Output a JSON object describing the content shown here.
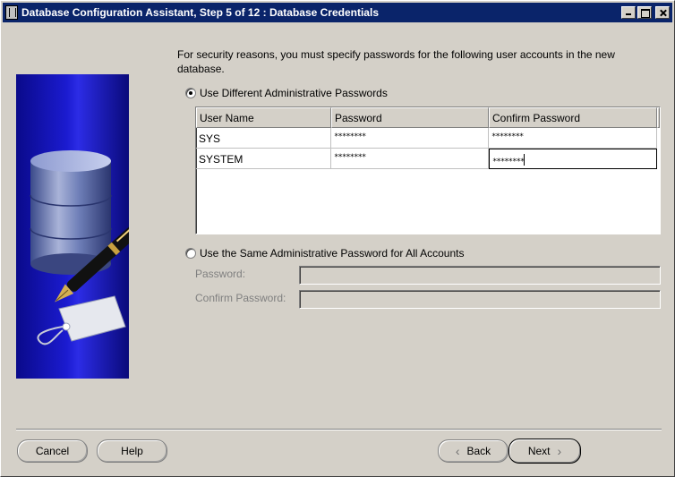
{
  "window": {
    "title": "Database Configuration Assistant, Step 5 of 12 : Database Credentials"
  },
  "intro_text": "For security reasons, you must specify passwords for the following user accounts in the new database.",
  "option_different": {
    "label": "Use Different Administrative Passwords",
    "selected": true
  },
  "credentials_table": {
    "columns": [
      "User Name",
      "Password",
      "Confirm Password"
    ],
    "rows": [
      {
        "user": "SYS",
        "password": "********",
        "confirm": "********"
      },
      {
        "user": "SYSTEM",
        "password": "********",
        "confirm": "********"
      }
    ]
  },
  "option_same": {
    "label": "Use the Same Administrative Password for All Accounts",
    "selected": false,
    "password_label": "Password:",
    "confirm_label": "Confirm Password:"
  },
  "buttons": {
    "cancel": "Cancel",
    "help": "Help",
    "back": "Back",
    "next": "Next"
  },
  "icons": {
    "title": "java-cup-icon",
    "illustration": "database-pen-illustration"
  },
  "colors": {
    "titlebar": "#0a246a",
    "panel": "#d4d0c8",
    "art_blue": "#1b1bd0"
  }
}
